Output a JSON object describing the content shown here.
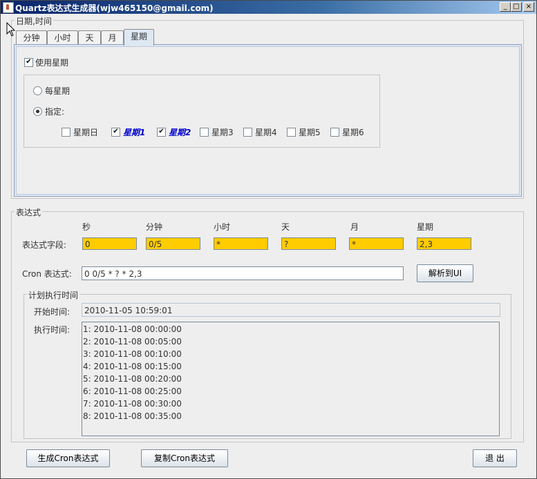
{
  "window": {
    "title": "Quartz表达式生成器(wjw465150@gmail.com)",
    "controls": {
      "minimize": "_",
      "maximize": "□",
      "close": "×"
    }
  },
  "datetime_group": {
    "title": "日期,时间",
    "tabs": [
      "分钟",
      "小时",
      "天",
      "月",
      "星期"
    ],
    "selected_tab": "星期",
    "use_week_label": "使用星期",
    "use_week_checked": true,
    "every_week_label": "每星期",
    "specify_label": "指定:",
    "specify_selected": true,
    "weekdays": [
      {
        "label": "星期日",
        "checked": false
      },
      {
        "label": "星期1",
        "checked": true
      },
      {
        "label": "星期2",
        "checked": true
      },
      {
        "label": "星期3",
        "checked": false
      },
      {
        "label": "星期4",
        "checked": false
      },
      {
        "label": "星期5",
        "checked": false
      },
      {
        "label": "星期6",
        "checked": false
      }
    ]
  },
  "expression_group": {
    "title": "表达式",
    "column_headers": [
      "秒",
      "分钟",
      "小时",
      "天",
      "月",
      "星期"
    ],
    "fields_label": "表达式字段:",
    "field_values": [
      "0",
      "0/5",
      "*",
      "?",
      "*",
      "2,3"
    ],
    "cron_label": "Cron 表达式:",
    "cron_value": "0 0/5 * ? * 2,3",
    "parse_button": "解析到UI",
    "highlight_color": "#ffcc00"
  },
  "schedule_group": {
    "title": "计划执行时间",
    "start_label": "开始时间:",
    "start_value": "2010-11-05 10:59:01",
    "exec_label": "执行时间:",
    "exec_times": [
      "1: 2010-11-08 00:00:00",
      "2: 2010-11-08 00:05:00",
      "3: 2010-11-08 00:10:00",
      "4: 2010-11-08 00:15:00",
      "5: 2010-11-08 00:20:00",
      "6: 2010-11-08 00:25:00",
      "7: 2010-11-08 00:30:00",
      "8: 2010-11-08 00:35:00"
    ]
  },
  "footer": {
    "generate_button": "生成Cron表达式",
    "copy_button": "复制Cron表达式",
    "exit_button": "退 出"
  }
}
